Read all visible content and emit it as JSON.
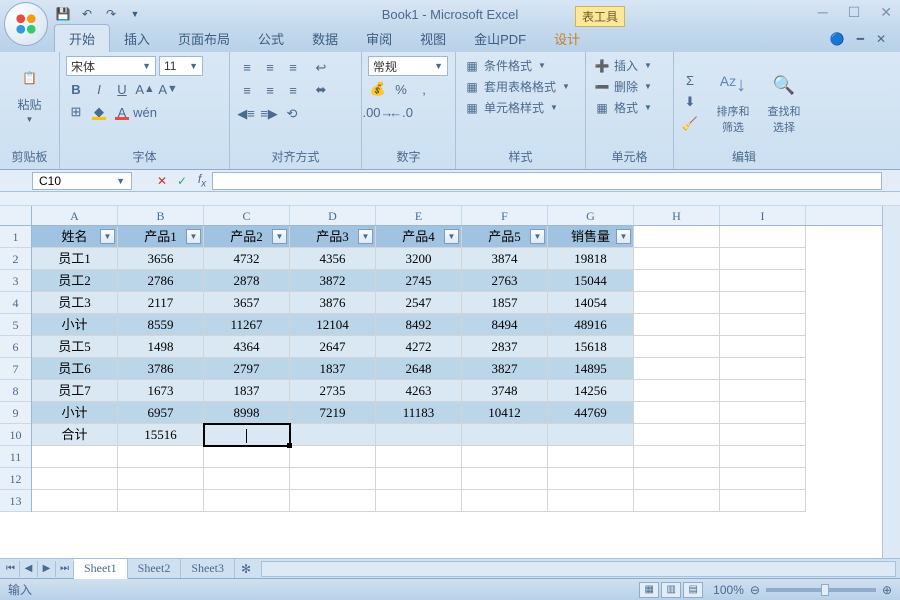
{
  "title": "Book1 - Microsoft Excel",
  "tool_tab": "表工具",
  "tabs": [
    "开始",
    "插入",
    "页面布局",
    "公式",
    "数据",
    "审阅",
    "视图",
    "金山PDF",
    "设计"
  ],
  "active_tab": 0,
  "groups": {
    "clipboard": {
      "label": "剪贴板",
      "paste": "粘贴"
    },
    "font": {
      "label": "字体",
      "name": "宋体",
      "size": "11"
    },
    "align": {
      "label": "对齐方式"
    },
    "number": {
      "label": "数字",
      "format": "常规"
    },
    "styles": {
      "label": "样式",
      "cond": "条件格式",
      "tblfmt": "套用表格格式",
      "cellstyle": "单元格样式"
    },
    "cells": {
      "label": "单元格",
      "insert": "插入",
      "delete": "删除",
      "format": "格式"
    },
    "editing": {
      "label": "编辑",
      "sort": "排序和\n筛选",
      "find": "查找和\n选择"
    }
  },
  "namebox": "C10",
  "columns": [
    "A",
    "B",
    "C",
    "D",
    "E",
    "F",
    "G",
    "H",
    "I"
  ],
  "headers": [
    "姓名",
    "产品1",
    "产品2",
    "产品3",
    "产品4",
    "产品5",
    "销售量"
  ],
  "rows": [
    [
      "员工1",
      "3656",
      "4732",
      "4356",
      "3200",
      "3874",
      "19818"
    ],
    [
      "员工2",
      "2786",
      "2878",
      "3872",
      "2745",
      "2763",
      "15044"
    ],
    [
      "员工3",
      "2117",
      "3657",
      "3876",
      "2547",
      "1857",
      "14054"
    ],
    [
      "小计",
      "8559",
      "11267",
      "12104",
      "8492",
      "8494",
      "48916"
    ],
    [
      "员工5",
      "1498",
      "4364",
      "2647",
      "4272",
      "2837",
      "15618"
    ],
    [
      "员工6",
      "3786",
      "2797",
      "1837",
      "2648",
      "3827",
      "14895"
    ],
    [
      "员工7",
      "1673",
      "1837",
      "2735",
      "4263",
      "3748",
      "14256"
    ],
    [
      "小计",
      "6957",
      "8998",
      "7219",
      "11183",
      "10412",
      "44769"
    ],
    [
      "合计",
      "15516",
      "",
      "",
      "",
      "",
      ""
    ]
  ],
  "sheets": [
    "Sheet1",
    "Sheet2",
    "Sheet3"
  ],
  "active_sheet": 0,
  "status_text": "输入",
  "zoom": "100%",
  "chart_data": {
    "type": "table",
    "title": "销售量",
    "columns": [
      "姓名",
      "产品1",
      "产品2",
      "产品3",
      "产品4",
      "产品5",
      "销售量"
    ],
    "data": [
      [
        "员工1",
        3656,
        4732,
        4356,
        3200,
        3874,
        19818
      ],
      [
        "员工2",
        2786,
        2878,
        3872,
        2745,
        2763,
        15044
      ],
      [
        "员工3",
        2117,
        3657,
        3876,
        2547,
        1857,
        14054
      ],
      [
        "小计",
        8559,
        11267,
        12104,
        8492,
        8494,
        48916
      ],
      [
        "员工5",
        1498,
        4364,
        2647,
        4272,
        2837,
        15618
      ],
      [
        "员工6",
        3786,
        2797,
        1837,
        2648,
        3827,
        14895
      ],
      [
        "员工7",
        1673,
        1837,
        2735,
        4263,
        3748,
        14256
      ],
      [
        "小计",
        6957,
        8998,
        7219,
        11183,
        10412,
        44769
      ],
      [
        "合计",
        15516,
        null,
        null,
        null,
        null,
        null
      ]
    ]
  }
}
